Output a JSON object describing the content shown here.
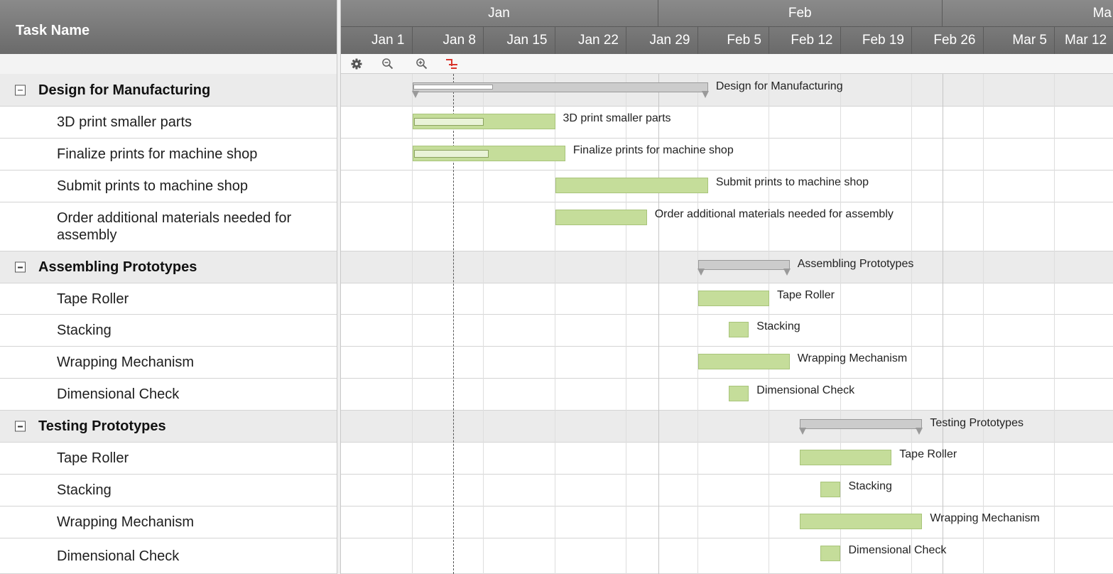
{
  "task_grid": {
    "header_label": "Task Name",
    "rows": [
      {
        "label": "Design for Manufacturing",
        "group": true
      },
      {
        "label": "3D print smaller parts",
        "group": false
      },
      {
        "label": "Finalize prints for machine shop",
        "group": false
      },
      {
        "label": "Submit prints to machine shop",
        "group": false
      },
      {
        "label": "Order additional materials needed for\nassembly",
        "group": false
      },
      {
        "label": "Assembling Prototypes",
        "group": true
      },
      {
        "label": "Tape Roller",
        "group": false
      },
      {
        "label": "Stacking",
        "group": false
      },
      {
        "label": "Wrapping Mechanism",
        "group": false
      },
      {
        "label": "Dimensional Check",
        "group": false
      },
      {
        "label": "Testing Prototypes",
        "group": true
      },
      {
        "label": "Tape Roller",
        "group": false
      },
      {
        "label": "Stacking",
        "group": false
      },
      {
        "label": "Wrapping Mechanism",
        "group": false
      },
      {
        "label": "Dimensional Check",
        "group": false
      }
    ]
  },
  "timeline": {
    "months": [
      "Jan",
      "Feb",
      "Ma"
    ],
    "weeks": [
      "Jan 1",
      "Jan 8",
      "Jan 15",
      "Jan 22",
      "Jan 29",
      "Feb 5",
      "Feb 12",
      "Feb 19",
      "Feb 26",
      "Mar 5",
      "Mar 12"
    ]
  },
  "toolbar": {
    "icons": [
      "gear-icon",
      "zoom-out-icon",
      "zoom-in-icon",
      "critical-path-icon"
    ]
  },
  "colors": {
    "task_bar": "#c5dd9a",
    "summary_bar": "#cccccc",
    "header": "#6e6e6e",
    "group_row": "#ebebeb",
    "critical_icon": "#d9342b"
  },
  "gantt": {
    "today": "Jan 12",
    "bars": [
      {
        "row": 0,
        "type": "summary",
        "start": "Jan 8",
        "end": "Feb 5",
        "progress": 0.27,
        "label": "Design for Manufacturing"
      },
      {
        "row": 1,
        "type": "task",
        "start": "Jan 8",
        "end": "Jan 21",
        "progress": 0.5,
        "label": "3D print smaller parts"
      },
      {
        "row": 2,
        "type": "task",
        "start": "Jan 8",
        "end": "Jan 22",
        "progress": 0.5,
        "label": "Finalize prints for machine shop"
      },
      {
        "row": 3,
        "type": "task",
        "start": "Jan 22",
        "end": "Feb 5",
        "progress": 0,
        "label": "Submit prints to machine shop"
      },
      {
        "row": 4,
        "type": "task",
        "start": "Jan 22",
        "end": "Jan 30",
        "progress": 0,
        "label": "Order additional materials needed for assembly"
      },
      {
        "row": 5,
        "type": "summary",
        "start": "Feb 5",
        "end": "Feb 13",
        "progress": 0,
        "label": "Assembling Prototypes"
      },
      {
        "row": 6,
        "type": "task",
        "start": "Feb 5",
        "end": "Feb 11",
        "progress": 0,
        "label": "Tape Roller"
      },
      {
        "row": 7,
        "type": "task",
        "start": "Feb 8",
        "end": "Feb 9",
        "progress": 0,
        "label": "Stacking"
      },
      {
        "row": 8,
        "type": "task",
        "start": "Feb 5",
        "end": "Feb 13",
        "progress": 0,
        "label": "Wrapping Mechanism"
      },
      {
        "row": 9,
        "type": "task",
        "start": "Feb 8",
        "end": "Feb 9",
        "progress": 0,
        "label": "Dimensional Check"
      },
      {
        "row": 10,
        "type": "summary",
        "start": "Feb 15",
        "end": "Feb 26",
        "progress": 0,
        "label": "Testing Prototypes"
      },
      {
        "row": 11,
        "type": "task",
        "start": "Feb 15",
        "end": "Feb 23",
        "progress": 0,
        "label": "Tape Roller"
      },
      {
        "row": 12,
        "type": "task",
        "start": "Feb 17",
        "end": "Feb 18",
        "progress": 0,
        "label": "Stacking"
      },
      {
        "row": 13,
        "type": "task",
        "start": "Feb 15",
        "end": "Feb 26",
        "progress": 0,
        "label": "Wrapping Mechanism"
      },
      {
        "row": 14,
        "type": "task",
        "start": "Feb 17",
        "end": "Feb 18",
        "progress": 0,
        "label": "Dimensional Check"
      }
    ]
  }
}
